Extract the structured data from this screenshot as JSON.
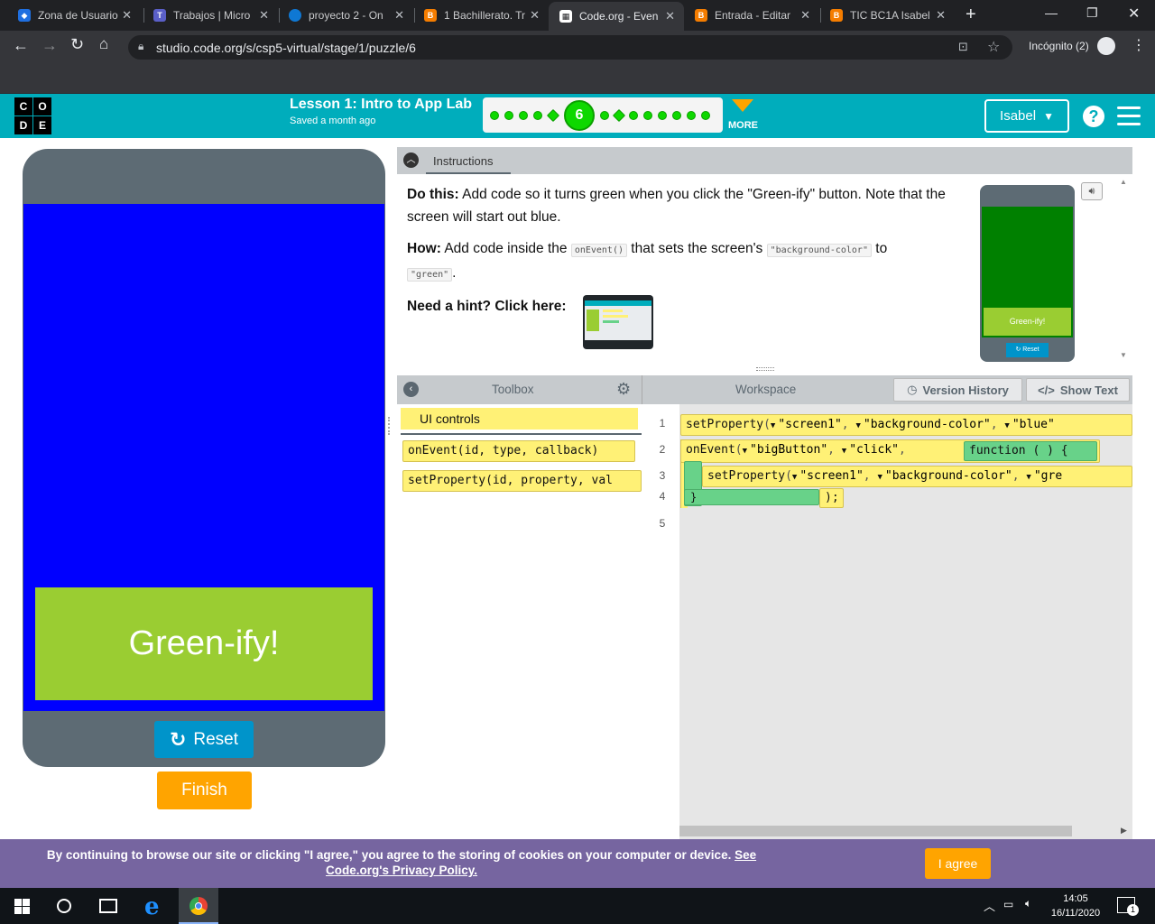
{
  "browser": {
    "tabs": [
      {
        "title": "Zona de Usuario",
        "color": "#1f6fe0"
      },
      {
        "title": "Trabajos | Micro",
        "color": "#5a5fc8"
      },
      {
        "title": "proyecto 2 - On",
        "color": "#0f78d4"
      },
      {
        "title": "1 Bachillerato. Tr",
        "color": "#f57d00"
      },
      {
        "title": "Code.org - Even",
        "color": "#ffffff"
      },
      {
        "title": "Entrada - Editar",
        "color": "#f57d00"
      },
      {
        "title": "TIC BC1A Isabel",
        "color": "#f57d00"
      }
    ],
    "url": "studio.code.org/s/csp5-virtual/stage/1/puzzle/6",
    "incognito_label": "Incógnito (2)"
  },
  "header": {
    "lesson_title": "Lesson 1: Intro to App Lab",
    "saved": "Saved a month ago",
    "current_level": "6",
    "more_label": "MORE",
    "user": "Isabel",
    "logo_letters": [
      "C",
      "O",
      "D",
      "E"
    ]
  },
  "app": {
    "button_label": "Green-ify!",
    "reset_label": "Reset",
    "finish_label": "Finish",
    "colors": {
      "screen": "#0000ff",
      "button": "#9acd32",
      "accent": "#00adbc"
    }
  },
  "instructions": {
    "tab": "Instructions",
    "do_this_label": "Do this:",
    "do_this_text": " Add code so it turns green when you click the \"Green-ify\" button. Note that the screen will start out blue.",
    "how_label": "How:",
    "how_text_1": " Add code inside the ",
    "how_code_1": "onEvent()",
    "how_text_2": " that sets the screen's ",
    "how_code_2": "\"background-color\"",
    "how_text_3": " to",
    "how_code_3": "\"green\"",
    "how_text_4": ".",
    "hint_label": "Need a hint? Click here:",
    "mini_button": "Green-ify!",
    "mini_reset": "Reset"
  },
  "toolbox": {
    "title": "Toolbox",
    "category": "UI controls",
    "blocks": [
      "onEvent(id, type, callback)",
      "setProperty(id, property, val"
    ]
  },
  "workspace": {
    "title": "Workspace",
    "version_history": "Version History",
    "show_text": "Show Text",
    "line_numbers": [
      "1",
      "2",
      "3",
      "4",
      "5"
    ],
    "line1": {
      "fn": "setProperty",
      "args": [
        "\"screen1\"",
        "\"background-color\"",
        "\"blue\""
      ]
    },
    "line2": {
      "fn": "onEvent",
      "args": [
        "\"bigButton\"",
        "\"click\""
      ],
      "function_label": "function ( ) {"
    },
    "line3": {
      "fn": "setProperty",
      "args": [
        "\"screen1\"",
        "\"background-color\"",
        "\"gre"
      ]
    },
    "line4": {
      "close_brace": "}",
      "close_paren": ");"
    }
  },
  "cookie": {
    "text": "By continuing to browse our site or clicking \"I agree,\" you agree to the storing of cookies on your computer or device. ",
    "link": "See Code.org's Privacy Policy.",
    "agree": "I agree"
  },
  "taskbar": {
    "time": "14:05",
    "date": "16/11/2020",
    "notifications": "1"
  }
}
